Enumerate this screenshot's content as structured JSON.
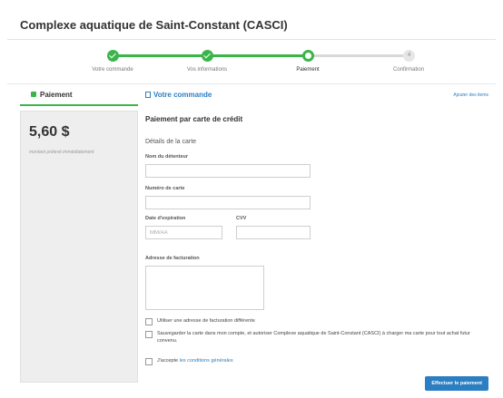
{
  "header": {
    "title": "Complexe aquatique de Saint-Constant (CASCI)"
  },
  "steps": [
    {
      "label": "Votre commande",
      "state": "done"
    },
    {
      "label": "Vos informations",
      "state": "done"
    },
    {
      "label": "Paiement",
      "state": "current"
    },
    {
      "label": "Confirmation",
      "state": "todo",
      "number": "4"
    }
  ],
  "colors": {
    "accent_green": "#3bb54a",
    "link_blue": "#2b7ec1",
    "panel_grey": "#eeeeee"
  },
  "left_panel": {
    "tab_label": "Paiement",
    "tab_icon": "lock-icon",
    "amount": "5,60 $",
    "amount_note": "montant prélevé immédiatement"
  },
  "order_tab": {
    "label": "Votre commande",
    "icon": "document-icon"
  },
  "add_items_link": "Ajouter des items",
  "form": {
    "title": "Paiement par carte de crédit",
    "section": "Détails de la carte",
    "holder_label": "Nom du détenteur",
    "holder_value": "",
    "card_label": "Numéro de carte",
    "card_value": "",
    "expiry_label": "Date d'expiration",
    "expiry_placeholder": "MM/AA",
    "cvv_label": "CVV",
    "cvv_value": "",
    "billing_label": "Adresse de facturation",
    "billing_value": "",
    "check_other_address": "Utiliser une adresse de facturation différente",
    "check_save_card": "Sauvegarder la carte dans mon compte, et autoriser Complexe aquatique de Saint-Constant (CASCI) à charger ma carte pour tout achat futur convenu.",
    "check_accept_prefix": "J'accepte",
    "check_accept_link": "les conditions générales",
    "submit_label": "Effectuer le paiement"
  }
}
